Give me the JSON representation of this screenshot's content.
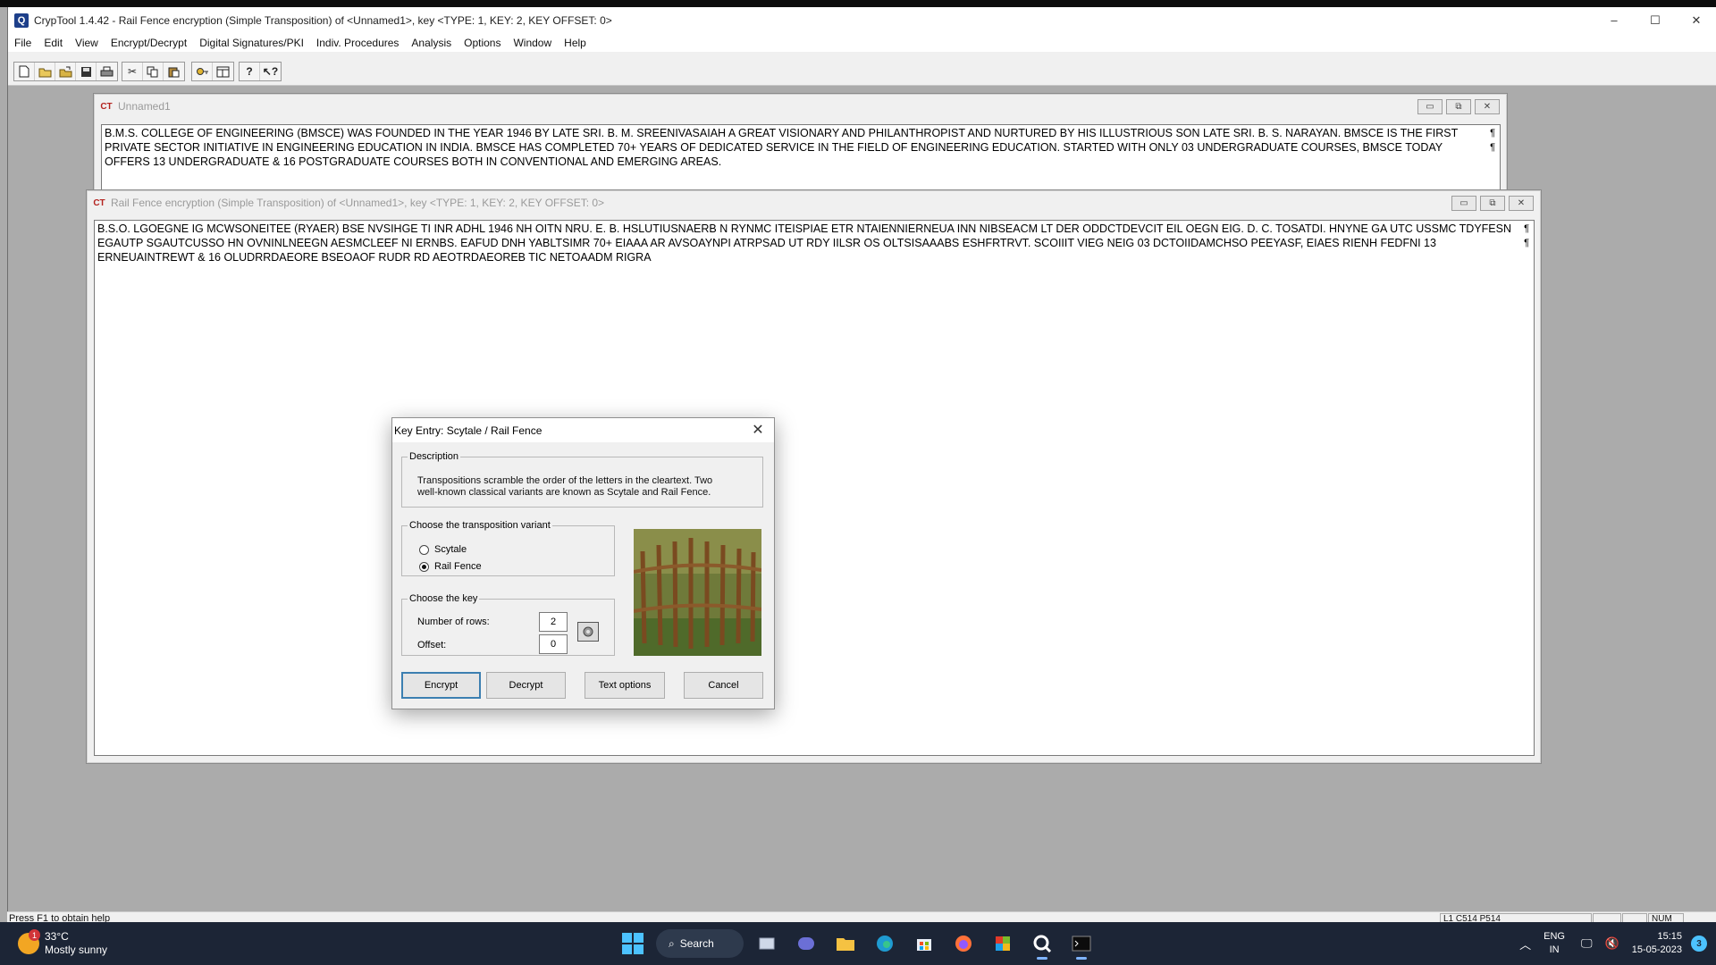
{
  "app": {
    "title": "CrypTool 1.4.42 - Rail Fence encryption (Simple Transposition) of <Unnamed1>, key <TYPE: 1, KEY: 2, KEY OFFSET: 0>",
    "icon_letter": "Q",
    "window_controls": {
      "minimize": "–",
      "maximize": "☐",
      "close": "✕"
    }
  },
  "menu": [
    "File",
    "Edit",
    "View",
    "Encrypt/Decrypt",
    "Digital Signatures/PKI",
    "Indiv. Procedures",
    "Analysis",
    "Options",
    "Window",
    "Help"
  ],
  "toolbar": {
    "group1": [
      "new-icon",
      "open-icon",
      "open-folder-icon",
      "save-icon",
      "print-icon"
    ],
    "group2": [
      "cut-icon",
      "copy-icon",
      "paste-icon"
    ],
    "group3": [
      "key-icon",
      "window-icon"
    ],
    "group4": [
      "help-icon",
      "context-help-icon"
    ]
  },
  "child_windows": {
    "unnamed": {
      "title": "Unnamed1",
      "text": "B.M.S. COLLEGE OF ENGINEERING (BMSCE) WAS FOUNDED IN THE YEAR 1946 BY LATE SRI. B. M. SREENIVASAIAH A GREAT VISIONARY AND PHILANTHROPIST AND NURTURED BY HIS ILLUSTRIOUS SON LATE SRI. B. S. NARAYAN. BMSCE IS THE FIRST PRIVATE SECTOR INITIATIVE IN ENGINEERING EDUCATION IN INDIA. BMSCE HAS COMPLETED 70+ YEARS OF DEDICATED SERVICE IN THE FIELD OF ENGINEERING EDUCATION. STARTED WITH ONLY 03 UNDERGRADUATE COURSES, BMSCE TODAY OFFERS 13 UNDERGRADUATE & 16 POSTGRADUATE COURSES BOTH IN CONVENTIONAL AND EMERGING AREAS."
    },
    "railfence": {
      "title": "Rail Fence encryption (Simple Transposition) of <Unnamed1>, key <TYPE: 1, KEY: 2, KEY OFFSET: 0>",
      "text": "B.S.O. LGOEGNE IG MCWSONEITEE (RYAER) BSE NVSIHGE TI INR ADHL 1946 NH OITN NRU. E. B. HSLUTIUSNAERB N RYNMC ITEISPIAE ETR NTAIENNIERNEUA INN NIBSEACM LT DER ODDCTDEVCIT EIL OEGN EIG. D. C. TOSATDI. HNYNE GA UTC USSMC TDYFESN EGAUTP SGAUTCUSSO HN OVNINLNEEGN AESMCLEEF NI ERNBS. EAFUD DNH YABLTSIMR 70+ EIAAA AR AVSOAYNPI ATRPSAD UT RDY IILSR OS OLTSISAAABS ESHFRTRVT. SCOIIIT VIEG NEIG 03 DCTOIIDAMCHSO PEEYASF, EIAES RIENH FEDFNI 13 ERNEUAINTREWT & 16 OLUDRRDAEORE BSEOAOF RUDR RD AEOTRDAEOREB TIC NETOAADM RIGRA"
    },
    "child_controls": {
      "minimize": "▭",
      "restore": "⧉",
      "close": "✕"
    },
    "para_mark": "¶"
  },
  "dialog": {
    "title": "Key Entry: Scytale / Rail Fence",
    "close": "✕",
    "description_legend": "Description",
    "description_text": "Transpositions scramble the order of the letters in the cleartext. Two well-known classical variants are known as Scytale and Rail Fence.",
    "variant_legend": "Choose the transposition variant",
    "variants": [
      {
        "label": "Scytale",
        "selected": false
      },
      {
        "label": "Rail Fence",
        "selected": true
      }
    ],
    "key_legend": "Choose the key",
    "rows_label": "Number of rows:",
    "rows_value": "2",
    "offset_label": "Offset:",
    "offset_value": "0",
    "key_icon": "gear-icon",
    "buttons": {
      "encrypt": "Encrypt",
      "decrypt": "Decrypt",
      "text_options": "Text options",
      "cancel": "Cancel"
    }
  },
  "statusbar": {
    "left": "Press F1 to obtain help",
    "position": "L1 C514 P514",
    "num": "NUM"
  },
  "taskbar": {
    "weather_temp": "33°C",
    "weather_desc": "Mostly sunny",
    "weather_badge": "1",
    "search_label": "Search",
    "lang_top": "ENG",
    "lang_bottom": "IN",
    "time": "15:15",
    "date": "15-05-2023",
    "notifications": "3",
    "accent": "#4cc2ff"
  }
}
